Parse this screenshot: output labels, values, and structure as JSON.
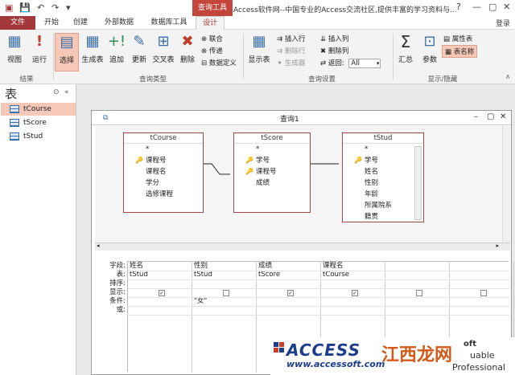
{
  "titlebar": {
    "context_tab": "查询工具",
    "title": "Access软件网--中国专业的Access交流社区,提供丰富的学习资料与...",
    "help": "?",
    "min": "—",
    "restore": "▢",
    "close": "✕",
    "login": "登录"
  },
  "tabs": [
    "文件",
    "开始",
    "创建",
    "外部数据",
    "数据库工具",
    "设计"
  ],
  "ribbon": {
    "results": {
      "view": "视图",
      "run": "运行",
      "group": "结果"
    },
    "query_type": {
      "select": "选择",
      "make_table": "生成表",
      "append": "追加",
      "update": "更新",
      "crosstab": "交叉表",
      "delete": "删除",
      "union": "联合",
      "pass_through": "传递",
      "data_definition": "数据定义",
      "group": "查询类型"
    },
    "setup": {
      "show_table": "显示表",
      "insert_rows": "插入行",
      "delete_rows": "删除行",
      "builder": "生成器",
      "insert_cols": "插入列",
      "delete_cols": "删除列",
      "return_label": "返回:",
      "return_value": "All",
      "group": "查询设置"
    },
    "show_hide": {
      "totals": "汇总",
      "parameters": "参数",
      "property_sheet": "属性表",
      "table_names": "表名称",
      "group": "显示/隐藏"
    }
  },
  "nav": {
    "title": "表",
    "items": [
      "tCourse",
      "tScore",
      "tStud"
    ]
  },
  "query": {
    "title": "查询1",
    "tables": [
      {
        "name": "tCourse",
        "fields": [
          "*",
          "课程号",
          "课程名",
          "学分",
          "选修课程"
        ],
        "keys": [
          1
        ]
      },
      {
        "name": "tScore",
        "fields": [
          "*",
          "学号",
          "课程号",
          "成绩"
        ],
        "keys": [
          1,
          2
        ]
      },
      {
        "name": "tStud",
        "fields": [
          "*",
          "学号",
          "姓名",
          "性别",
          "年龄",
          "所属院系",
          "籍贯"
        ],
        "keys": [
          1
        ]
      }
    ],
    "row_labels": [
      "字段:",
      "表:",
      "排序:",
      "显示:",
      "条件:",
      "或:"
    ],
    "columns": [
      {
        "field": "姓名",
        "table": "tStud",
        "show": true,
        "criteria": ""
      },
      {
        "field": "性别",
        "table": "tStud",
        "show": false,
        "criteria": "\"女\""
      },
      {
        "field": "成绩",
        "table": "tScore",
        "show": true,
        "criteria": ""
      },
      {
        "field": "课程名",
        "table": "tCourse",
        "show": true,
        "criteria": ""
      },
      {
        "field": "",
        "table": "",
        "show": false,
        "criteria": ""
      },
      {
        "field": "",
        "table": "",
        "show": false,
        "criteria": ""
      }
    ]
  },
  "watermark": {
    "brand": "ACCESS",
    "url": "www.accessoft.com",
    "overlay": "江西龙网",
    "t1": "oft",
    "t2": "uable",
    "t3": "Professional"
  }
}
